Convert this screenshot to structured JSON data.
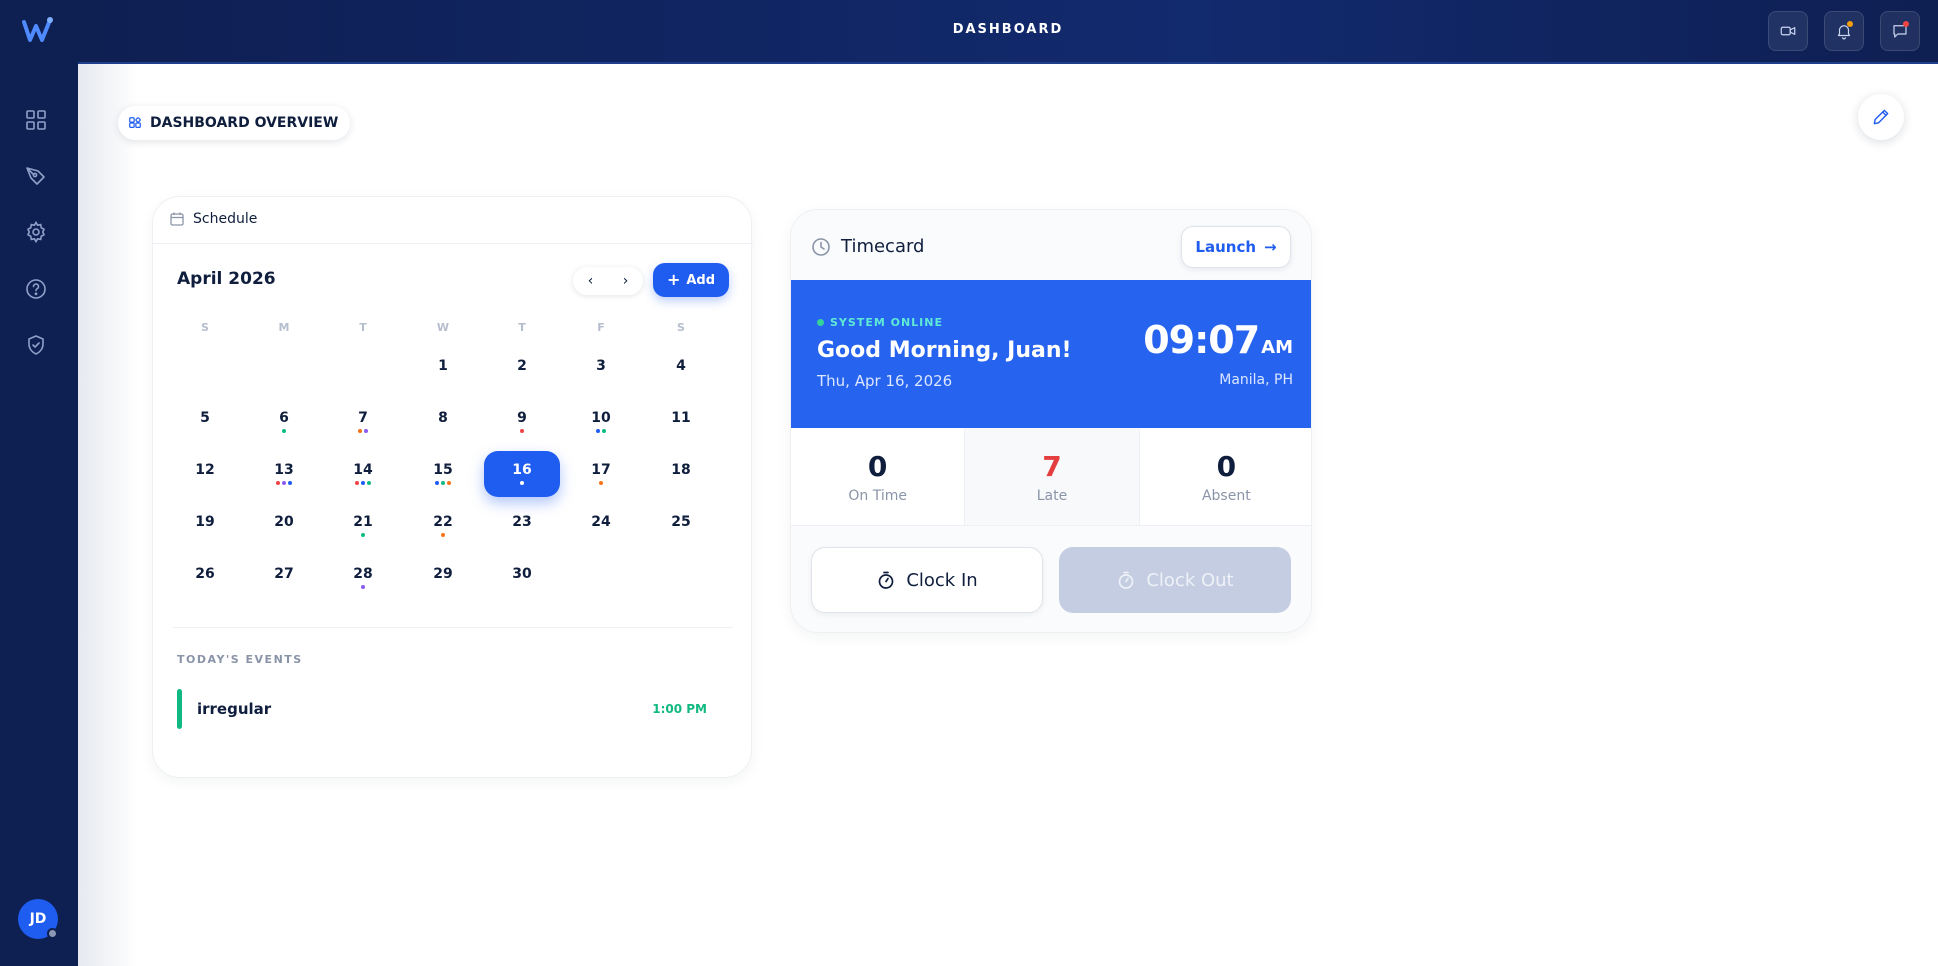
{
  "header": {
    "title": "DASHBOARD"
  },
  "sidebar": {
    "icons": [
      "grid-icon",
      "pen-tool-icon",
      "gear-icon",
      "help-icon",
      "shield-icon"
    ],
    "avatar_initials": "JD"
  },
  "page": {
    "overview_label": "DASHBOARD OVERVIEW"
  },
  "schedule": {
    "title": "Schedule",
    "month": "April 2026",
    "add_label": "Add",
    "nav_prev": "‹",
    "nav_next": "›",
    "weekdays": [
      "S",
      "M",
      "T",
      "W",
      "T",
      "F",
      "S"
    ],
    "days": [
      {
        "n": "1",
        "dots": []
      },
      {
        "n": "2",
        "dots": []
      },
      {
        "n": "3",
        "dots": []
      },
      {
        "n": "4",
        "dots": []
      },
      {
        "n": "5",
        "dots": []
      },
      {
        "n": "6",
        "dots": [
          "#10b981"
        ]
      },
      {
        "n": "7",
        "dots": [
          "#f97316",
          "#8b5cf6"
        ]
      },
      {
        "n": "8",
        "dots": []
      },
      {
        "n": "9",
        "dots": [
          "#ef4444"
        ]
      },
      {
        "n": "10",
        "dots": [
          "#1f5cf0",
          "#10b981"
        ]
      },
      {
        "n": "11",
        "dots": []
      },
      {
        "n": "12",
        "dots": []
      },
      {
        "n": "13",
        "dots": [
          "#ef4444",
          "#8b5cf6",
          "#1f5cf0"
        ]
      },
      {
        "n": "14",
        "dots": [
          "#ef4444",
          "#1f5cf0",
          "#10b981"
        ]
      },
      {
        "n": "15",
        "dots": [
          "#1f5cf0",
          "#10b981",
          "#f97316"
        ]
      },
      {
        "n": "16",
        "dots": [
          "#ffffff"
        ],
        "selected": true
      },
      {
        "n": "17",
        "dots": [
          "#f97316"
        ]
      },
      {
        "n": "18",
        "dots": []
      },
      {
        "n": "19",
        "dots": []
      },
      {
        "n": "20",
        "dots": []
      },
      {
        "n": "21",
        "dots": [
          "#10b981"
        ]
      },
      {
        "n": "22",
        "dots": [
          "#f97316"
        ]
      },
      {
        "n": "23",
        "dots": []
      },
      {
        "n": "24",
        "dots": []
      },
      {
        "n": "25",
        "dots": []
      },
      {
        "n": "26",
        "dots": []
      },
      {
        "n": "27",
        "dots": []
      },
      {
        "n": "28",
        "dots": [
          "#8b5cf6"
        ]
      },
      {
        "n": "29",
        "dots": []
      },
      {
        "n": "30",
        "dots": []
      }
    ],
    "events_label": "TODAY'S EVENTS",
    "events": [
      {
        "name": "irregular",
        "time": "1:00 PM",
        "color": "#10b981"
      }
    ]
  },
  "timecard": {
    "title": "Timecard",
    "launch_label": "Launch",
    "status": "SYSTEM ONLINE",
    "greeting": "Good Morning, Juan!",
    "date": "Thu, Apr 16, 2026",
    "time": "09:07",
    "ampm": "AM",
    "location": "Manila, PH",
    "stats": [
      {
        "value": "0",
        "label": "On Time"
      },
      {
        "value": "7",
        "label": "Late"
      },
      {
        "value": "0",
        "label": "Absent"
      }
    ],
    "clock_in_label": "Clock In",
    "clock_out_label": "Clock Out"
  },
  "colors": {
    "accent": "#1f5cf0",
    "sidebar": "#0e1f52",
    "success": "#10b981",
    "danger": "#e53e3e",
    "video_badge": "#f59e0b",
    "chat_badge": "#ef4444"
  }
}
